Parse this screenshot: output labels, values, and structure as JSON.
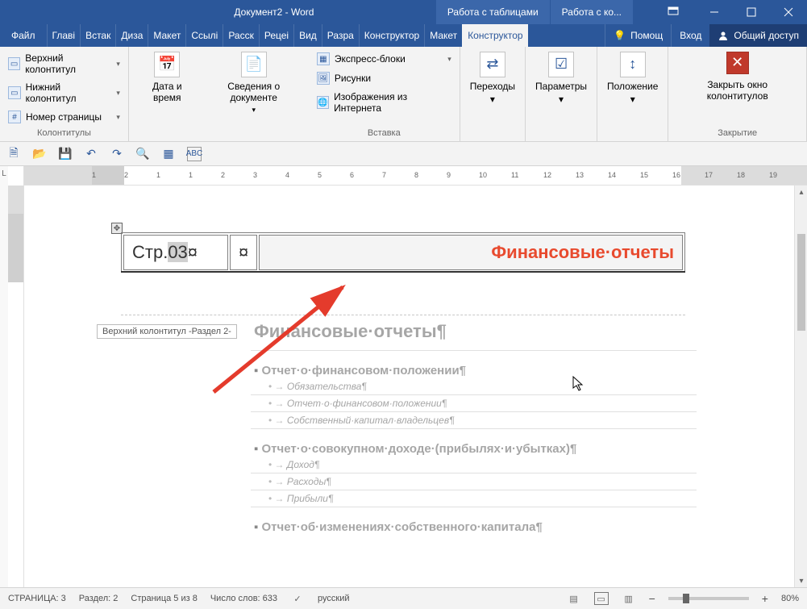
{
  "window": {
    "title": "Документ2 - Word"
  },
  "context_tabs": [
    "Работа с таблицами",
    "Работа с ко..."
  ],
  "ribbon_tabs": {
    "file": "Файл",
    "tabs": [
      "Главі",
      "Встак",
      "Диза",
      "Макет",
      "Ссылі",
      "Расск",
      "Рецеі",
      "Вид",
      "Разра",
      "Конструктор",
      "Макет",
      "Конструктор"
    ],
    "help_label": "Помощ",
    "signin_label": "Вход",
    "share_label": "Общий доступ"
  },
  "ribbon": {
    "colontitles": {
      "header": "Верхний колонтитул",
      "footer": "Нижний колонтитул",
      "pagenum": "Номер страницы",
      "group": "Колонтитулы"
    },
    "datetime": {
      "btn": "Дата и время"
    },
    "docinfo": {
      "btn": "Сведения о документе"
    },
    "insert": {
      "quickparts": "Экспресс-блоки",
      "pictures": "Рисунки",
      "online_pictures": "Изображения из Интернета",
      "group": "Вставка"
    },
    "nav": {
      "btn": "Переходы"
    },
    "params": {
      "btn": "Параметры"
    },
    "position": {
      "btn": "Положение"
    },
    "close": {
      "btn": "Закрыть окно колонтитулов",
      "group": "Закрытие"
    }
  },
  "document": {
    "header_label": "Верхний колонтитул -Раздел 2-",
    "page_prefix": "Стр.",
    "page_number": "03",
    "end_cell": "¤",
    "report_title": "Финансовые·отчеты",
    "h1": "Финансовые·отчеты¶",
    "sections": [
      {
        "title": "Отчет·о·финансовом·положении¶",
        "items": [
          "Обязательства¶",
          "Отчет·о·финансовом·положении¶",
          "Собственный·капитал·владельцев¶"
        ]
      },
      {
        "title": "Отчет·о·совокупном·доходе·(прибылях·и·убытках)¶",
        "items": [
          "Доход¶",
          "Расходы¶",
          "Прибыли¶"
        ]
      },
      {
        "title": "Отчет·об·изменениях·собственного·капитала¶",
        "items": []
      }
    ]
  },
  "ruler": {
    "h_marks": [
      "1",
      "2",
      "1",
      "1",
      "2",
      "3",
      "4",
      "5",
      "6",
      "7",
      "8",
      "9",
      "10",
      "11",
      "12",
      "13",
      "14",
      "15",
      "16",
      "17",
      "18",
      "19"
    ]
  },
  "status": {
    "page": "СТРАНИЦА: 3",
    "section": "Раздел: 2",
    "page_of": "Страница 5 из 8",
    "words": "Число слов: 633",
    "language": "русский",
    "zoom_pct": "80%"
  }
}
